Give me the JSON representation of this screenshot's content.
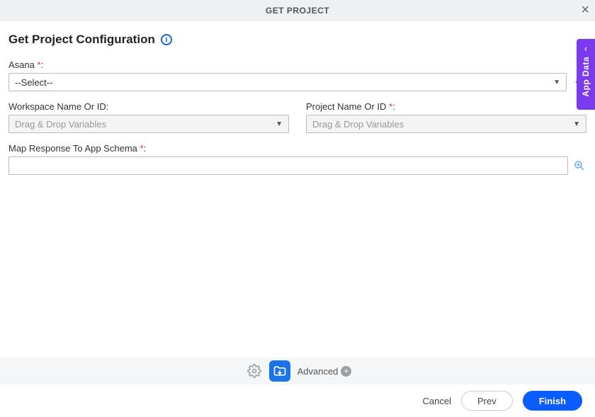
{
  "header": {
    "title": "GET PROJECT"
  },
  "sideTab": {
    "label": "App Data"
  },
  "page": {
    "title": "Get Project Configuration"
  },
  "fields": {
    "asana": {
      "label": "Asana",
      "required": "*",
      "value": "--Select--"
    },
    "workspace": {
      "label": "Workspace Name Or ID:",
      "placeholder": "Drag & Drop Variables"
    },
    "project": {
      "label": "Project Name Or ID",
      "required": "*",
      "placeholder": "Drag & Drop Variables"
    },
    "map": {
      "label": "Map Response To App Schema",
      "required": "*"
    }
  },
  "toolbar": {
    "advanced_label": "Advanced"
  },
  "footer": {
    "cancel": "Cancel",
    "prev": "Prev",
    "finish": "Finish"
  }
}
